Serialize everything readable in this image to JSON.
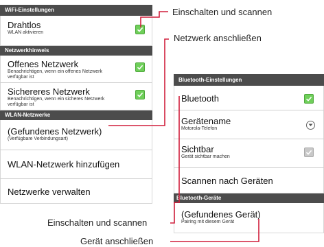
{
  "wifi": {
    "header": "WiFi-Einstellungen",
    "drahtlos": {
      "title": "Drahtlos",
      "subtitle": "WLAN aktivieren"
    },
    "section_hinweis": "Netzwerkhinweis",
    "offenes": {
      "title": "Offenes Netzwerk",
      "subtitle": "Benachrichtigen, wenn ein offenes Netzwerk verfügbar ist"
    },
    "sicheres": {
      "title": "Sichereres Netzwerk",
      "subtitle": "Benachrichtigen, wenn ein sicheres Netzwerk verfügbar ist"
    },
    "section_netzwerke": "WLAN-Netzwerke",
    "gefunden": {
      "title": "(Gefundenes Netzwerk)",
      "subtitle": "(Verfügbare Verbindungsart)"
    },
    "hinzufuegen": "WLAN-Netzwerk hinzufügen",
    "verwalten": "Netzwerke verwalten"
  },
  "bluetooth": {
    "header": "Bluetooth-Einstellungen",
    "bluetooth": "Bluetooth",
    "geraetename": {
      "title": "Gerätename",
      "subtitle": "Motorola-Telefon"
    },
    "sichtbar": {
      "title": "Sichtbar",
      "subtitle": "Gerät sichtbar machen"
    },
    "scannen": "Scannen nach Geräten",
    "section_geraete": "Bluetooth-Geräte",
    "gefunden": {
      "title": "(Gefundenes Gerät)",
      "subtitle": "Pairing mit diesem Gerät"
    }
  },
  "callouts": {
    "top_scan": "Einschalten und scannen",
    "netzwerk": "Netzwerk anschließen",
    "bottom_scan": "Einschalten und scannen",
    "geraet": "Gerät anschließen"
  },
  "colors": {
    "callout_line": "#d01f3c",
    "checkbox": "#6fcf5a",
    "header": "#4c4c4c"
  }
}
